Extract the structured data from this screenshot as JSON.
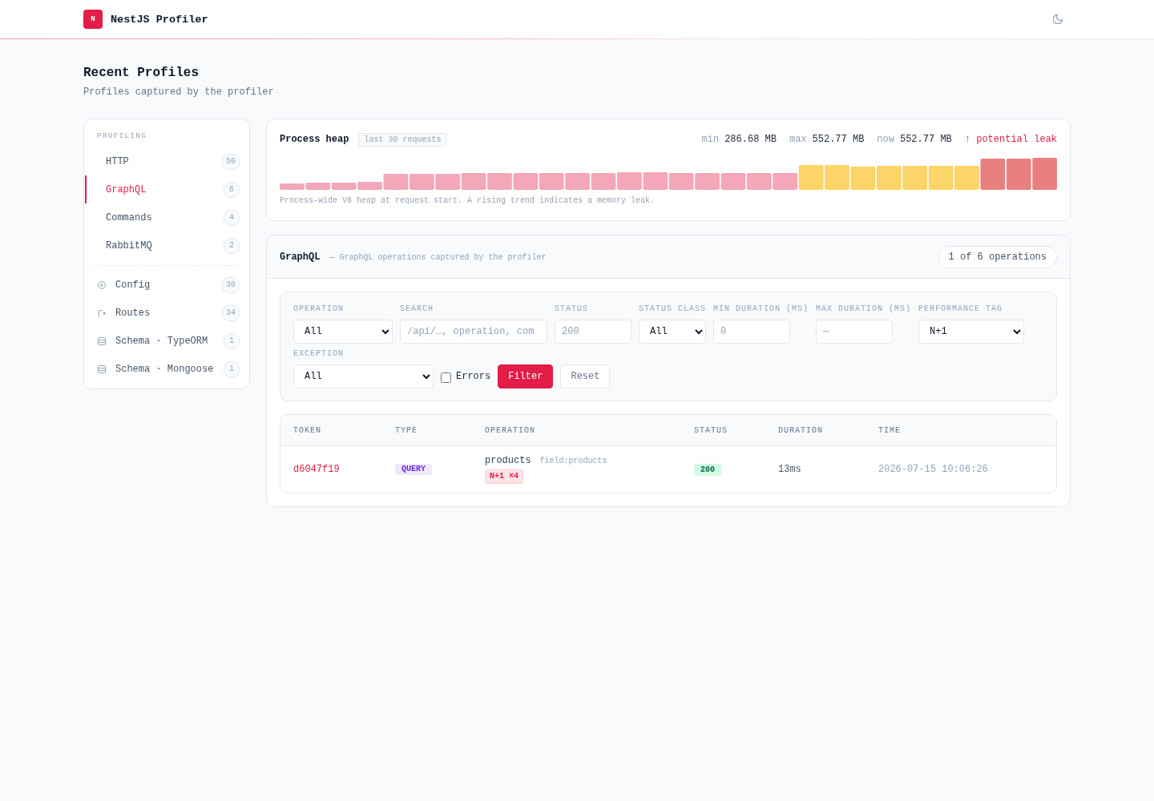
{
  "header": {
    "logo_text": "N",
    "title": "NestJS Profiler"
  },
  "page": {
    "title": "Recent Profiles",
    "subtitle": "Profiles captured by the profiler"
  },
  "sidebar": {
    "heading": "PROFILING",
    "profiling_items": [
      {
        "label": "HTTP",
        "count": "50",
        "selected": false
      },
      {
        "label": "GraphQL",
        "count": "6",
        "selected": true
      },
      {
        "label": "Commands",
        "count": "4",
        "selected": false
      },
      {
        "label": "RabbitMQ",
        "count": "2",
        "selected": false
      }
    ],
    "tool_items": [
      {
        "kind": "config",
        "label": "Config",
        "count": "30",
        "selected": false
      },
      {
        "kind": "routes",
        "label": "Routes",
        "count": "34",
        "selected": false
      },
      {
        "kind": "schema",
        "label": "Schema · TypeORM",
        "count": "1",
        "selected": false
      },
      {
        "kind": "schema",
        "label": "Schema · Mongoose",
        "count": "1",
        "selected": false
      }
    ]
  },
  "heap": {
    "title": "Process heap",
    "badge": "last 30 requests",
    "stats": [
      {
        "label": "min",
        "value": "286.68 MB"
      },
      {
        "label": "max",
        "value": "552.77 MB"
      },
      {
        "label": "now",
        "value": "552.77 MB"
      }
    ],
    "trend": "↑ potential leak",
    "caption": "Process-wide V8 heap at request start. A rising trend indicates a memory leak."
  },
  "graphql": {
    "title": "GraphQL",
    "subtitle": "— GraphQL operations captured by the profiler",
    "count": "1 of 6 operations",
    "filters": {
      "fields": [
        {
          "kind": "select",
          "label": "OPERATION",
          "value": "All"
        },
        {
          "kind": "text",
          "label": "SEARCH",
          "placeholder": "/api/…, operation, com"
        },
        {
          "kind": "text",
          "label": "STATUS",
          "placeholder": "200"
        },
        {
          "kind": "select",
          "label": "STATUS CLASS",
          "value": "All"
        },
        {
          "kind": "text",
          "label": "MIN DURATION (MS)",
          "placeholder": "0"
        },
        {
          "kind": "text",
          "label": "MAX DURATION (MS)",
          "placeholder": "—"
        },
        {
          "kind": "select",
          "label": "PERFORMANCE TAG",
          "value": "N+1"
        },
        {
          "kind": "select",
          "label": "EXCEPTION",
          "value": "All"
        }
      ],
      "errors": {
        "label": "Errors",
        "checked": false
      },
      "buttons": [
        {
          "kind": "primary",
          "label": "Filter"
        },
        {
          "kind": "secondary",
          "label": "Reset"
        }
      ]
    },
    "table": {
      "columns": [
        "TOKEN",
        "TYPE",
        "OPERATION",
        "STATUS",
        "DURATION",
        "TIME"
      ],
      "rows": [
        {
          "token": "d6047f19",
          "type": "QUERY",
          "operation": "products",
          "field": "field:products",
          "tags": [
            "N+1 ×4"
          ],
          "status": "200",
          "duration": "13ms",
          "time": "2026-07-15 10:06:26"
        }
      ]
    }
  }
}
